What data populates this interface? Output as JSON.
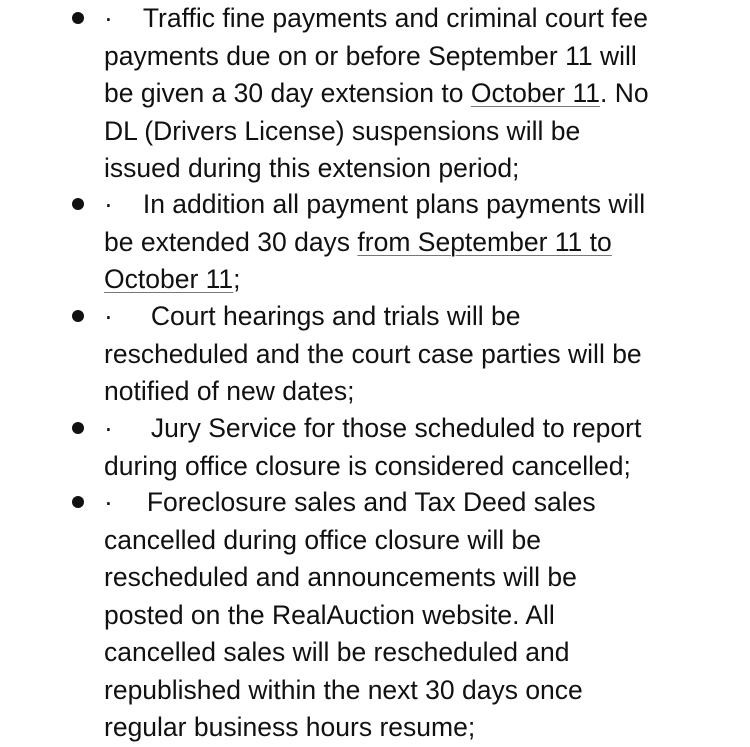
{
  "items": [
    {
      "marker": "·",
      "lines": [
        [
          "Traffic fine payments and criminal court fee"
        ],
        [
          "payments due on or before September 11 will"
        ],
        [
          "be given a 30 day extension to ",
          "October 11",
          ". No"
        ],
        [
          "DL (Drivers License) suspensions will be"
        ],
        [
          "issued during this extension period;"
        ]
      ]
    },
    {
      "marker": "·",
      "lines": [
        [
          "In addition all payment plans payments will"
        ],
        [
          "be extended 30 days ",
          "from September 11 to"
        ],
        [
          "October 11",
          ";"
        ]
      ]
    },
    {
      "marker": "·",
      "lines": [
        [
          "Court hearings and trials will be"
        ],
        [
          "rescheduled and the court case parties will be"
        ],
        [
          "notified of new dates;"
        ]
      ]
    },
    {
      "marker": "·",
      "lines": [
        [
          "Jury Service for those scheduled to report"
        ],
        [
          "during office closure is considered cancelled;"
        ]
      ]
    },
    {
      "marker": "·",
      "lines": [
        [
          "Foreclosure sales and Tax Deed sales"
        ],
        [
          "cancelled during office closure will be"
        ],
        [
          "rescheduled and announcements will be"
        ],
        [
          "posted on the RealAuction website. All"
        ],
        [
          "cancelled sales will be rescheduled and"
        ],
        [
          "republished within the next 30 days once"
        ],
        [
          "regular business hours resume;"
        ]
      ]
    }
  ]
}
